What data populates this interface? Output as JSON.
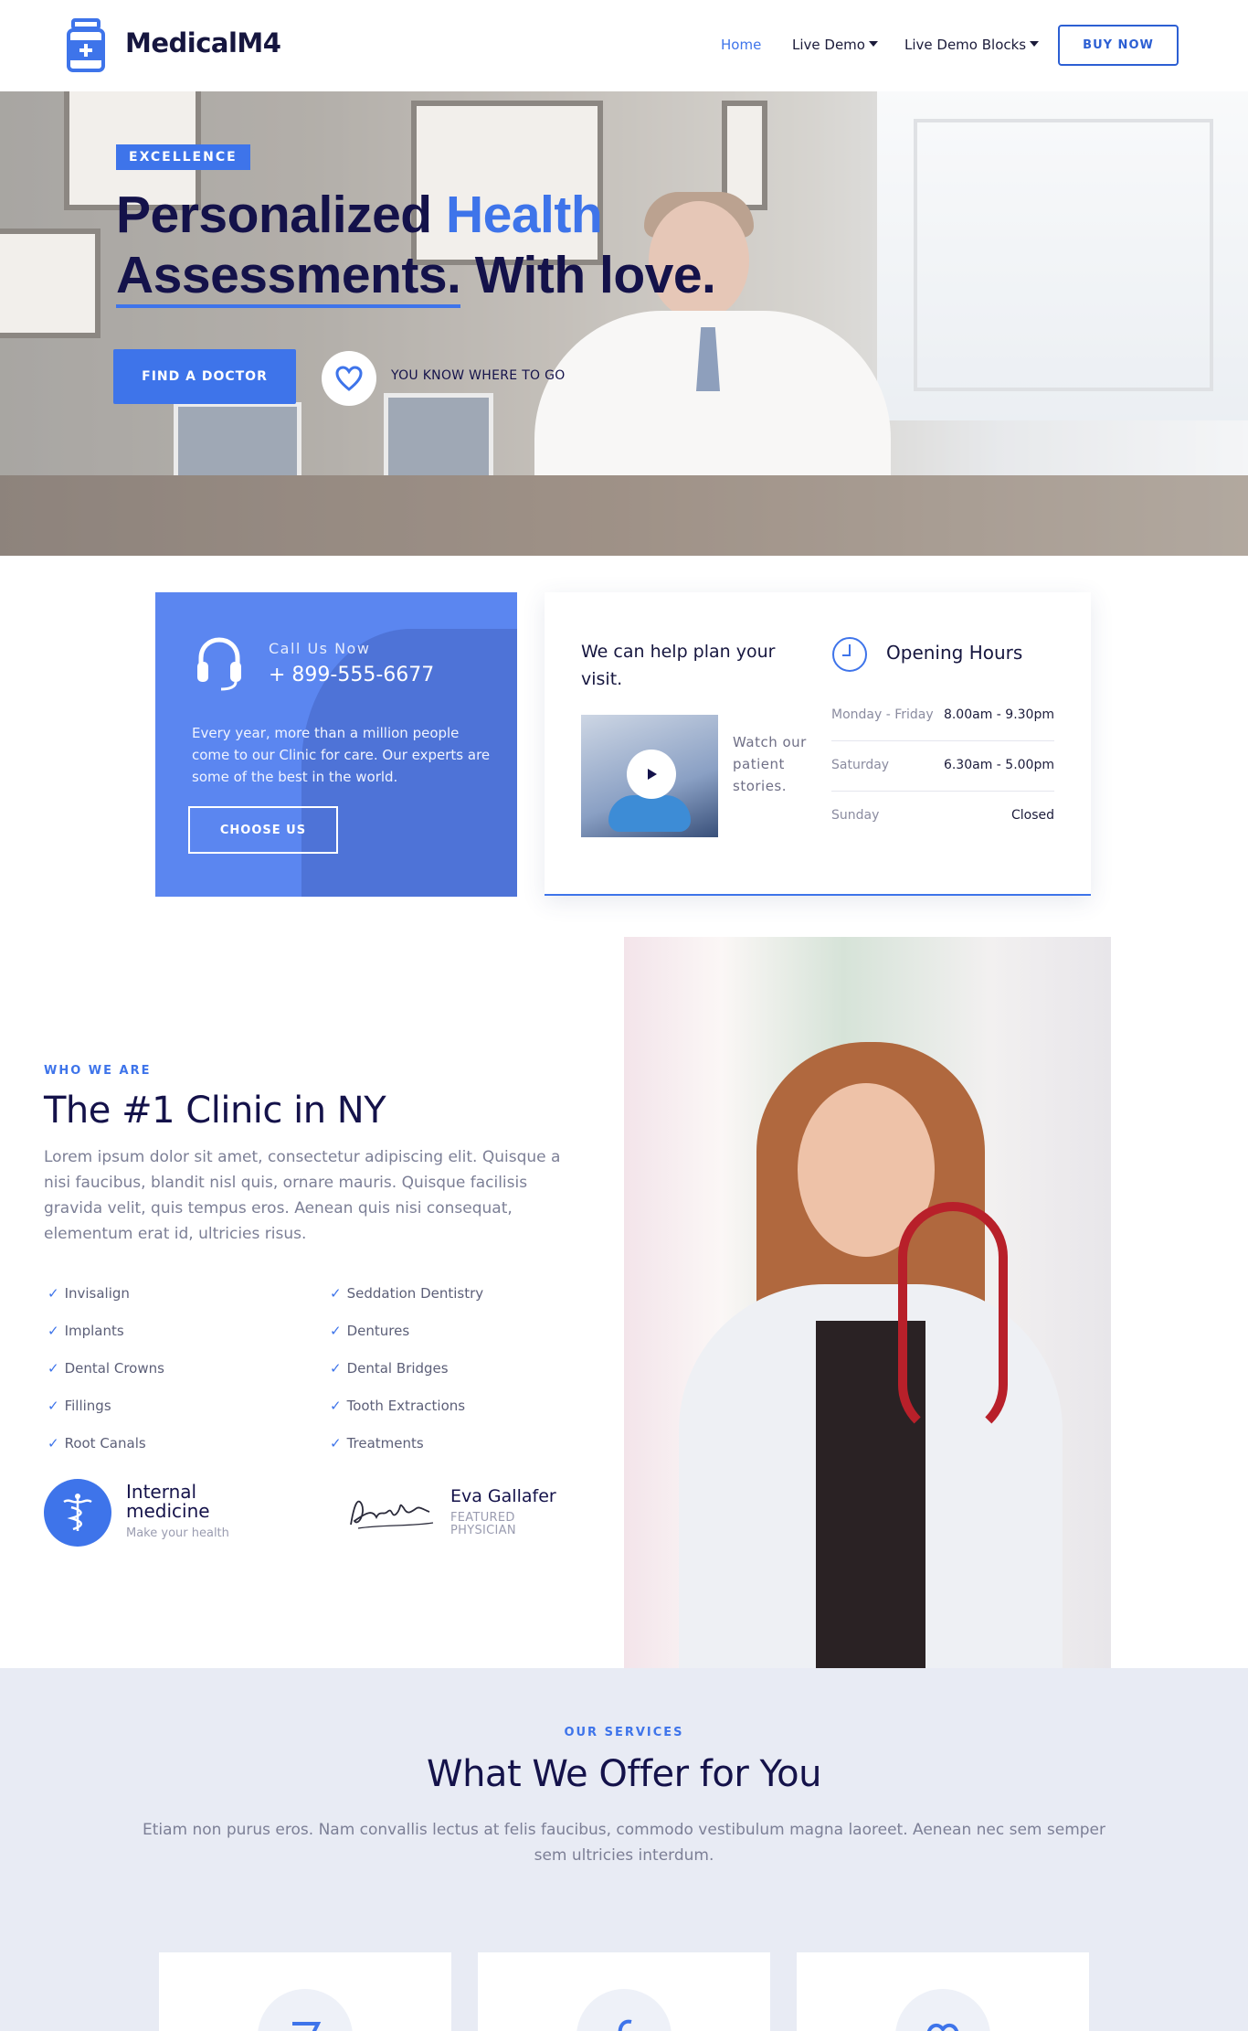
{
  "nav": {
    "brand": "MedicalM4",
    "items": [
      {
        "label": "Home",
        "active": true
      },
      {
        "label": "Live Demo",
        "dropdown": true
      },
      {
        "label": "Live Demo Blocks",
        "dropdown": true
      }
    ],
    "buy_label": "BUY NOW"
  },
  "hero": {
    "badge": "EXCELLENCE",
    "title_part1": "Personalized ",
    "title_highlight": "Health",
    "title_underlined": "Assessments.",
    "title_part2": " With love.",
    "cta_label": "FIND A DOCTOR",
    "tagline": "YOU KNOW WHERE TO GO"
  },
  "call_card": {
    "label": "Call Us Now",
    "phone": "+ 899-555-6677",
    "description": "Every year, more than a million people come to our Clinic for care. Our experts are some of the best in the world.",
    "button_label": "CHOOSE US"
  },
  "plan_card": {
    "title": "We can help plan your visit.",
    "watch_text": "Watch our patient stories.",
    "hours_title": "Opening Hours",
    "hours": [
      {
        "day": "Monday - Friday",
        "time": "8.00am - 9.30pm"
      },
      {
        "day": "Saturday",
        "time": "6.30am - 5.00pm"
      },
      {
        "day": "Sunday",
        "time": "Closed"
      }
    ]
  },
  "about": {
    "label": "WHO WE ARE",
    "title": "The #1 Clinic in NY",
    "description": "Lorem ipsum dolor sit amet, consectetur adipiscing elit. Quisque a nisi faucibus, blandit nisl quis, ornare mauris. Quisque facilisis gravida velit, quis tempus eros. Aenean quis nisi consequat, elementum erat id, ultricies risus.",
    "list_left": [
      "Invisalign",
      "Implants",
      "Dental Crowns",
      "Fillings",
      "Root Canals"
    ],
    "list_right": [
      "Seddation Dentistry",
      "Dentures",
      "Dental Bridges",
      "Tooth Extractions",
      "Treatments"
    ],
    "feature_title": "Internal medicine",
    "feature_sub": "Make your health",
    "physician_name": "Eva Gallafer",
    "physician_role": "FEATURED PHYSICIAN"
  },
  "services": {
    "label": "OUR SERVICES",
    "title": "What We Offer for You",
    "description": "Etiam non purus eros. Nam convallis lectus at felis faucibus, commodo vestibulum magna laoreet. Aenean nec sem semper sem ultricies interdum."
  },
  "colors": {
    "accent": "#3e74ea",
    "navy": "#14124a",
    "services_bg": "#e8ebf4"
  }
}
